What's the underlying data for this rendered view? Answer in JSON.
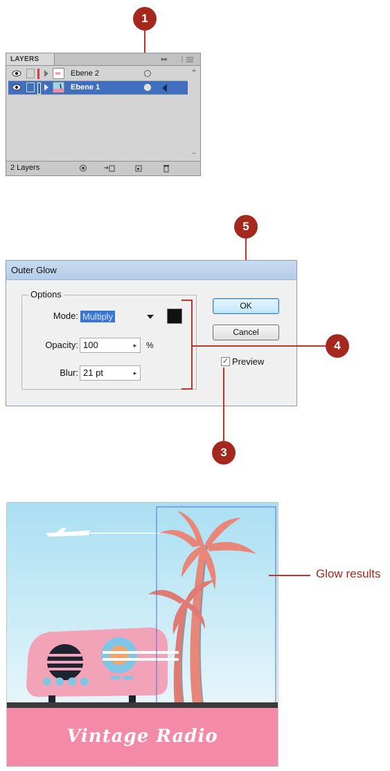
{
  "callouts": [
    "1",
    "5",
    "4",
    "3"
  ],
  "layers_panel": {
    "tab": "LAYERS",
    "tab_controls": "▸▸",
    "menu_icon": "panel-menu-icon",
    "rows": [
      {
        "name": "Ebene 2",
        "selected": false,
        "color": "#e03a3a"
      },
      {
        "name": "Ebene 1",
        "selected": true,
        "color": "#2f5fc8"
      }
    ],
    "count": "2 Layers",
    "footer_icons": [
      "make-clipping-mask-icon",
      "create-sublayer-icon",
      "create-layer-icon",
      "trash-icon"
    ]
  },
  "outer_glow": {
    "title": "Outer Glow",
    "group_label": "Options",
    "mode_label": "Mode:",
    "mode_value": "Multiply",
    "opacity_label": "Opacity:",
    "opacity_value": "100",
    "opacity_unit": "%",
    "blur_label": "Blur:",
    "blur_value": "21 pt",
    "glow_color": "#111111",
    "ok_label": "OK",
    "cancel_label": "Cancel",
    "preview_label": "Preview",
    "preview_checked": true
  },
  "artwork": {
    "title_text": "Vintage Radio",
    "sky_color": "#a9dff2",
    "pink_color": "#f28aa8",
    "palm_color": "#e8867a",
    "result_label": "Glow results"
  }
}
